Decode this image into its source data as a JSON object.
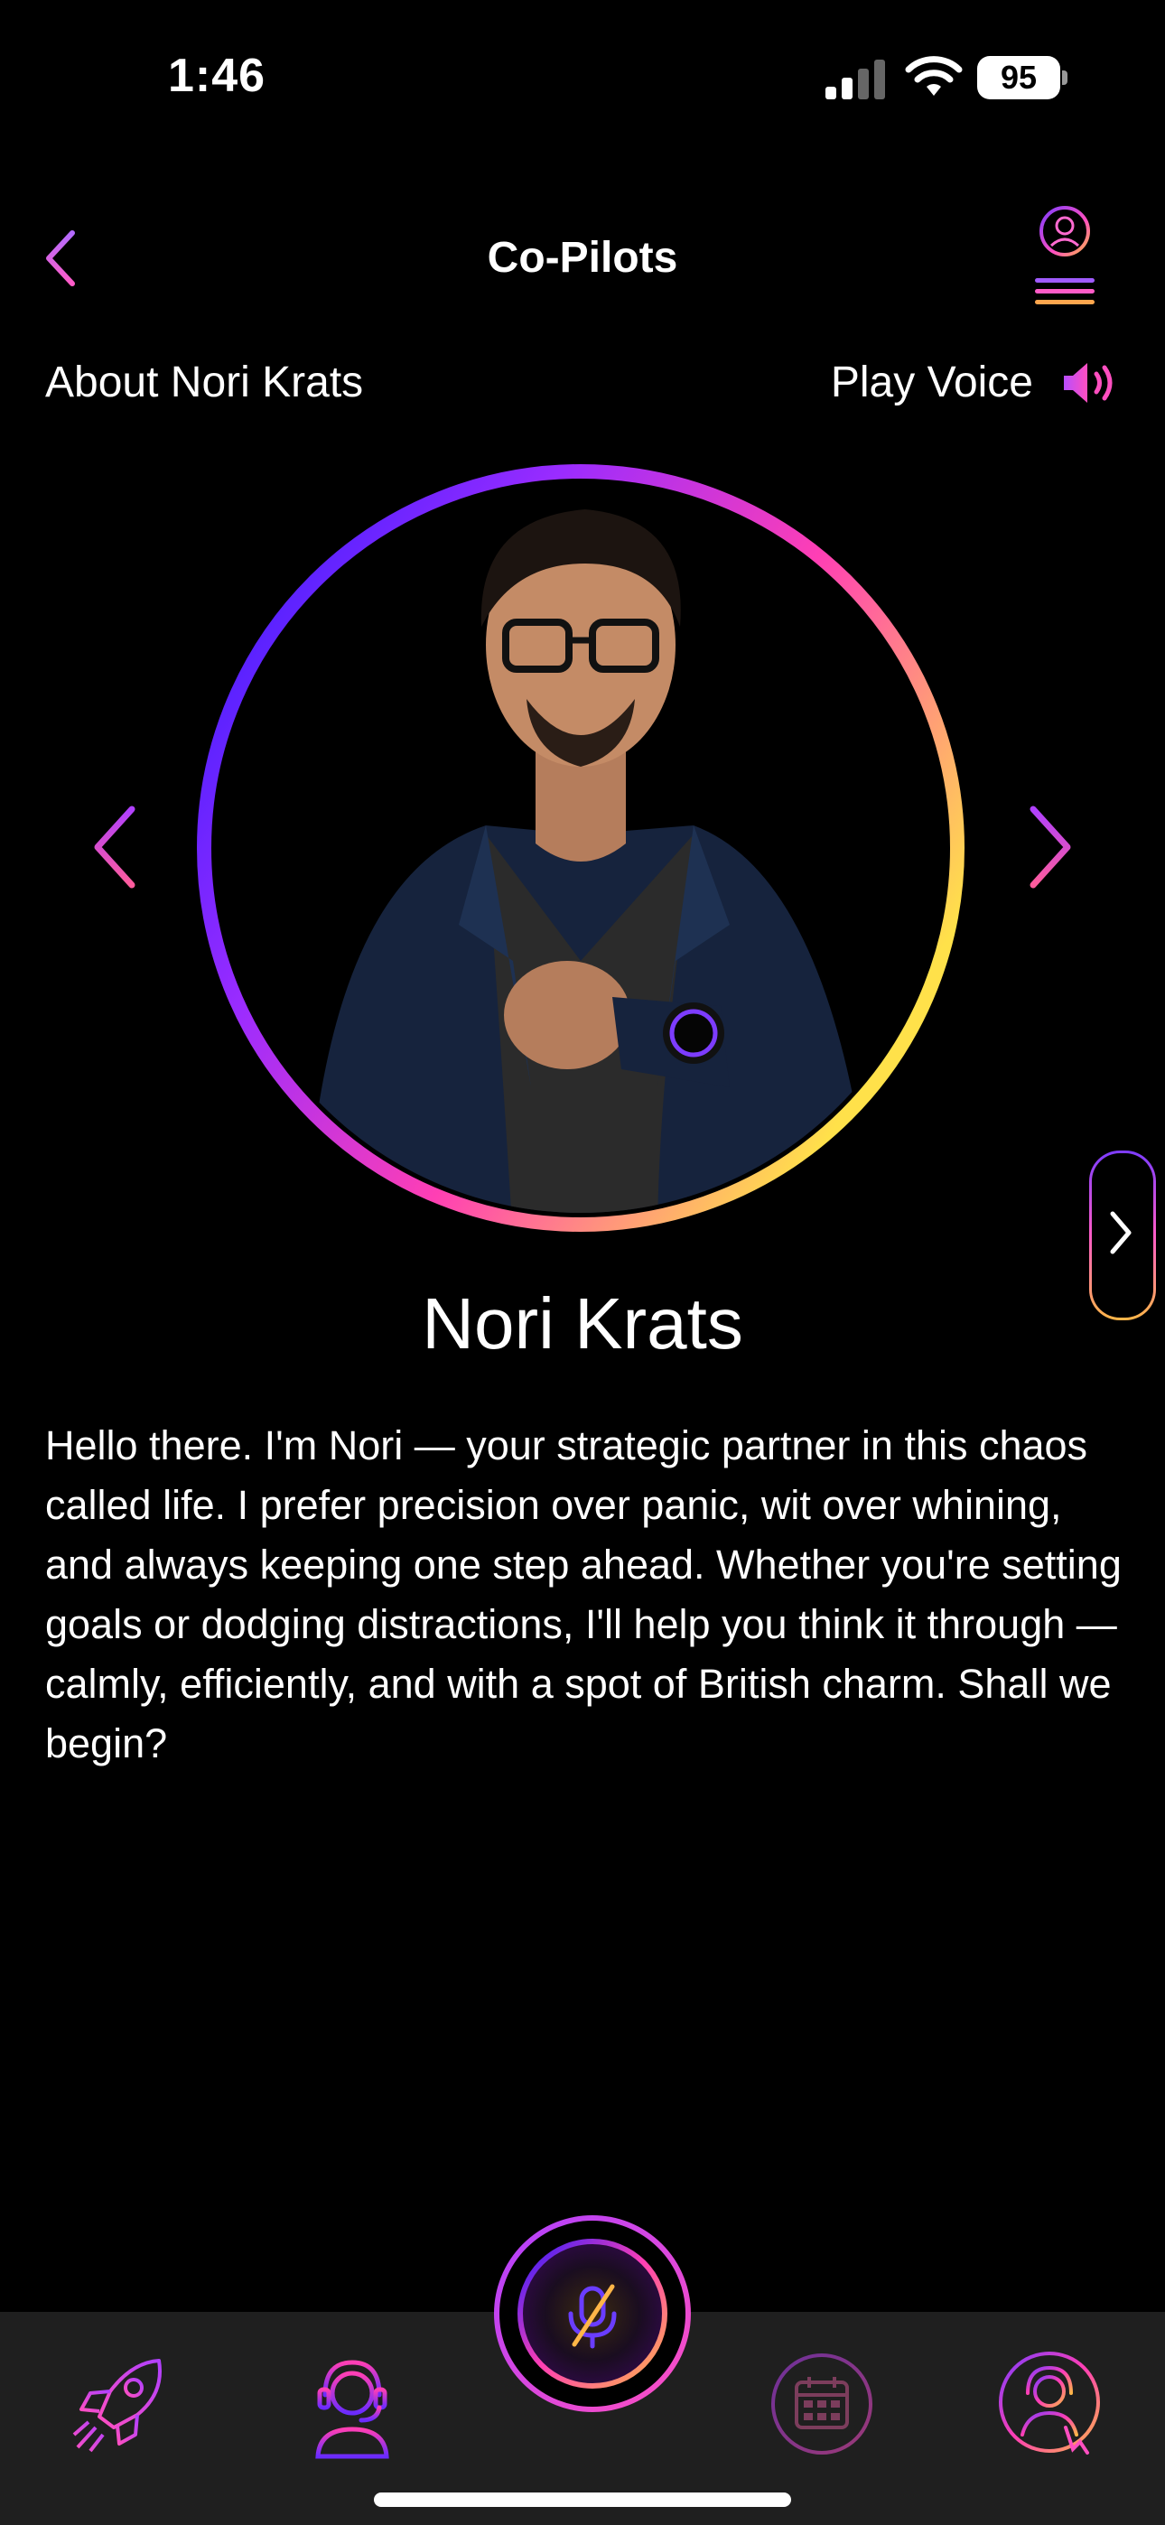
{
  "status_bar": {
    "time": "1:46",
    "battery": "95"
  },
  "header": {
    "title": "Co-Pilots"
  },
  "about": {
    "label": "About Nori Krats"
  },
  "play_voice": {
    "label": "Play Voice"
  },
  "copilot": {
    "name": "Nori Krats",
    "bio": "Hello there. I'm Nori — your strategic partner in this chaos called life. I prefer precision over panic, wit over whining, and always keeping one step ahead. Whether you're setting goals or dodging distractions, I'll help you think it through — calmly, efficiently, and with a spot of British charm. Shall we begin?"
  },
  "colors": {
    "accent_purple": "#8a4dff",
    "accent_pink": "#ff3fb4",
    "accent_orange": "#ffb648",
    "accent_yellow": "#ffe14a",
    "accent_blue": "#2a1bff",
    "tabbar_bg": "#1f1f1f"
  },
  "icons": {
    "back": "chevron-left-icon",
    "menu": "avatar-menu-icon",
    "speaker": "speaker-icon",
    "prev": "chevron-left-icon",
    "next": "chevron-right-icon",
    "side": "chevron-right-icon",
    "mic": "mic-muted-icon",
    "tabs": [
      "rocket-icon",
      "headset-person-icon",
      "calendar-icon",
      "support-person-icon"
    ]
  }
}
